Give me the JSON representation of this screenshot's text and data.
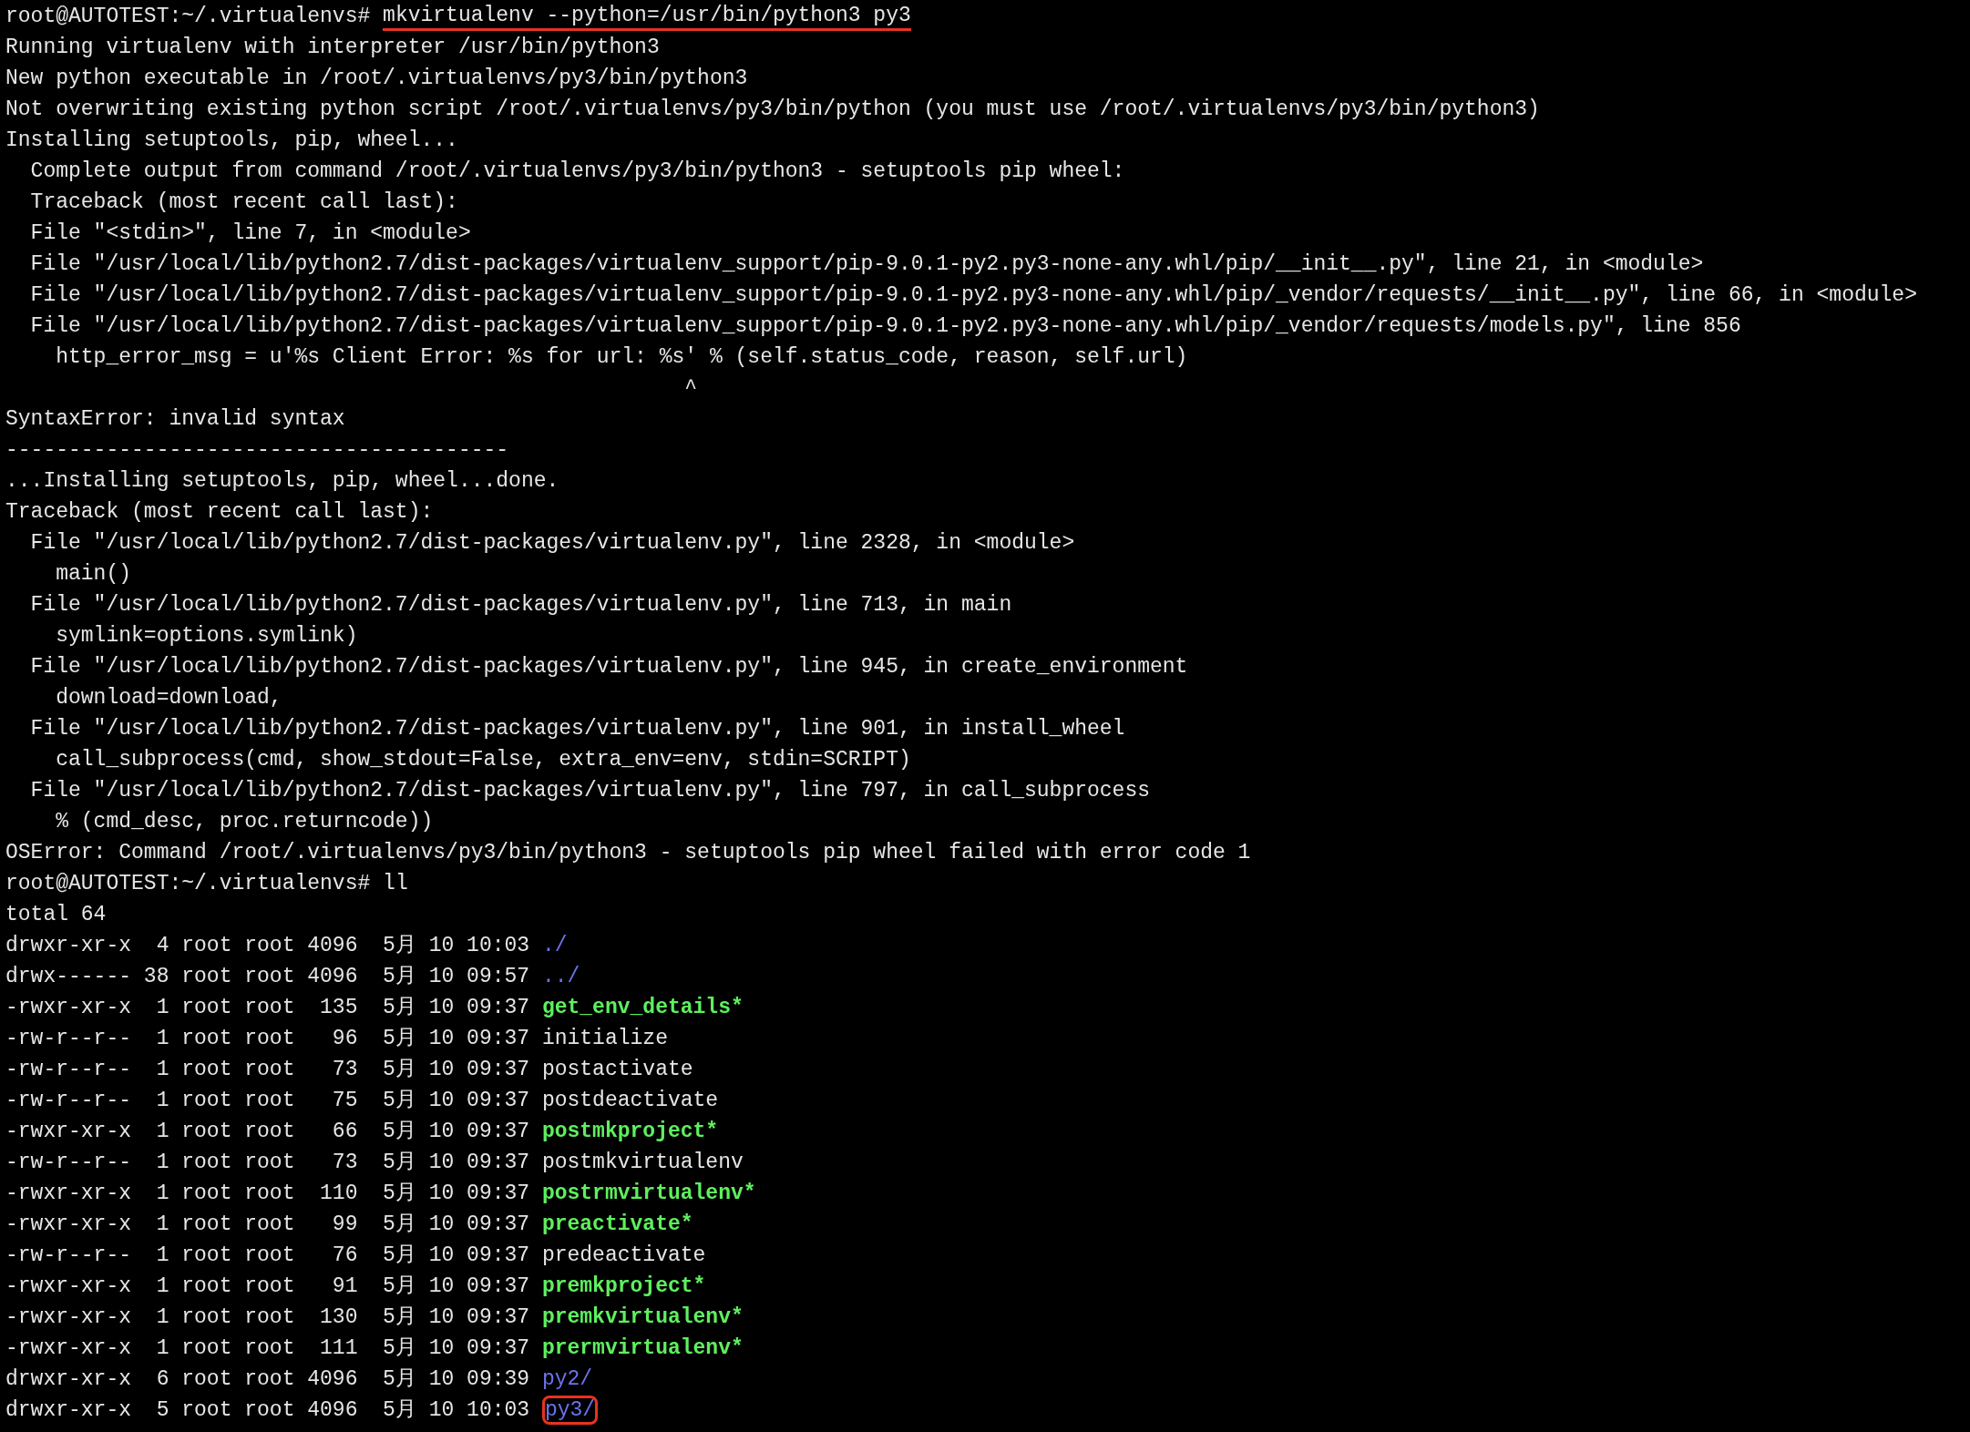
{
  "terminal": {
    "lines": [
      {
        "kind": "prompt",
        "prompt": "root@AUTOTEST:~/.virtualenvs# ",
        "command": "mkvirtualenv --python=/usr/bin/python3 py3",
        "underlined": true
      },
      {
        "kind": "text",
        "text": "Running virtualenv with interpreter /usr/bin/python3"
      },
      {
        "kind": "text",
        "text": "New python executable in /root/.virtualenvs/py3/bin/python3"
      },
      {
        "kind": "text",
        "text": "Not overwriting existing python script /root/.virtualenvs/py3/bin/python (you must use /root/.virtualenvs/py3/bin/python3)"
      },
      {
        "kind": "text",
        "text": "Installing setuptools, pip, wheel..."
      },
      {
        "kind": "text",
        "text": "  Complete output from command /root/.virtualenvs/py3/bin/python3 - setuptools pip wheel:"
      },
      {
        "kind": "text",
        "text": "  Traceback (most recent call last):"
      },
      {
        "kind": "text",
        "text": "  File \"<stdin>\", line 7, in <module>"
      },
      {
        "kind": "text",
        "text": "  File \"/usr/local/lib/python2.7/dist-packages/virtualenv_support/pip-9.0.1-py2.py3-none-any.whl/pip/__init__.py\", line 21, in <module>"
      },
      {
        "kind": "text",
        "text": "  File \"/usr/local/lib/python2.7/dist-packages/virtualenv_support/pip-9.0.1-py2.py3-none-any.whl/pip/_vendor/requests/__init__.py\", line 66, in <module>"
      },
      {
        "kind": "text",
        "text": "  File \"/usr/local/lib/python2.7/dist-packages/virtualenv_support/pip-9.0.1-py2.py3-none-any.whl/pip/_vendor/requests/models.py\", line 856"
      },
      {
        "kind": "text",
        "text": "    http_error_msg = u'%s Client Error: %s for url: %s' % (self.status_code, reason, self.url)"
      },
      {
        "kind": "text",
        "text": "                                                      ^"
      },
      {
        "kind": "text",
        "text": "SyntaxError: invalid syntax"
      },
      {
        "kind": "text",
        "text": "----------------------------------------"
      },
      {
        "kind": "text",
        "text": "...Installing setuptools, pip, wheel...done."
      },
      {
        "kind": "text",
        "text": "Traceback (most recent call last):"
      },
      {
        "kind": "text",
        "text": "  File \"/usr/local/lib/python2.7/dist-packages/virtualenv.py\", line 2328, in <module>"
      },
      {
        "kind": "text",
        "text": "    main()"
      },
      {
        "kind": "text",
        "text": "  File \"/usr/local/lib/python2.7/dist-packages/virtualenv.py\", line 713, in main"
      },
      {
        "kind": "text",
        "text": "    symlink=options.symlink)"
      },
      {
        "kind": "text",
        "text": "  File \"/usr/local/lib/python2.7/dist-packages/virtualenv.py\", line 945, in create_environment"
      },
      {
        "kind": "text",
        "text": "    download=download,"
      },
      {
        "kind": "text",
        "text": "  File \"/usr/local/lib/python2.7/dist-packages/virtualenv.py\", line 901, in install_wheel"
      },
      {
        "kind": "text",
        "text": "    call_subprocess(cmd, show_stdout=False, extra_env=env, stdin=SCRIPT)"
      },
      {
        "kind": "text",
        "text": "  File \"/usr/local/lib/python2.7/dist-packages/virtualenv.py\", line 797, in call_subprocess"
      },
      {
        "kind": "text",
        "text": "    % (cmd_desc, proc.returncode))"
      },
      {
        "kind": "text",
        "text": "OSError: Command /root/.virtualenvs/py3/bin/python3 - setuptools pip wheel failed with error code 1"
      },
      {
        "kind": "prompt",
        "prompt": "root@AUTOTEST:~/.virtualenvs# ",
        "command": "ll",
        "underlined": false
      },
      {
        "kind": "text",
        "text": "total 64"
      },
      {
        "kind": "ls",
        "info": "drwxr-xr-x  4 root root 4096  5月 10 10:03 ",
        "file": {
          "kind": "dir",
          "text": "./"
        },
        "circled": false
      },
      {
        "kind": "ls",
        "info": "drwx------ 38 root root 4096  5月 10 09:57 ",
        "file": {
          "kind": "dir",
          "text": "../"
        },
        "circled": false
      },
      {
        "kind": "ls",
        "info": "-rwxr-xr-x  1 root root  135  5月 10 09:37 ",
        "file": {
          "kind": "exec",
          "text": "get_env_details*"
        },
        "circled": false
      },
      {
        "kind": "ls",
        "info": "-rw-r--r--  1 root root   96  5月 10 09:37 ",
        "file": {
          "kind": "file",
          "text": "initialize"
        },
        "circled": false
      },
      {
        "kind": "ls",
        "info": "-rw-r--r--  1 root root   73  5月 10 09:37 ",
        "file": {
          "kind": "file",
          "text": "postactivate"
        },
        "circled": false
      },
      {
        "kind": "ls",
        "info": "-rw-r--r--  1 root root   75  5月 10 09:37 ",
        "file": {
          "kind": "file",
          "text": "postdeactivate"
        },
        "circled": false
      },
      {
        "kind": "ls",
        "info": "-rwxr-xr-x  1 root root   66  5月 10 09:37 ",
        "file": {
          "kind": "exec",
          "text": "postmkproject*"
        },
        "circled": false
      },
      {
        "kind": "ls",
        "info": "-rw-r--r--  1 root root   73  5月 10 09:37 ",
        "file": {
          "kind": "file",
          "text": "postmkvirtualenv"
        },
        "circled": false
      },
      {
        "kind": "ls",
        "info": "-rwxr-xr-x  1 root root  110  5月 10 09:37 ",
        "file": {
          "kind": "exec",
          "text": "postrmvirtualenv*"
        },
        "circled": false
      },
      {
        "kind": "ls",
        "info": "-rwxr-xr-x  1 root root   99  5月 10 09:37 ",
        "file": {
          "kind": "exec",
          "text": "preactivate*"
        },
        "circled": false
      },
      {
        "kind": "ls",
        "info": "-rw-r--r--  1 root root   76  5月 10 09:37 ",
        "file": {
          "kind": "file",
          "text": "predeactivate"
        },
        "circled": false
      },
      {
        "kind": "ls",
        "info": "-rwxr-xr-x  1 root root   91  5月 10 09:37 ",
        "file": {
          "kind": "exec",
          "text": "premkproject*"
        },
        "circled": false
      },
      {
        "kind": "ls",
        "info": "-rwxr-xr-x  1 root root  130  5月 10 09:37 ",
        "file": {
          "kind": "exec",
          "text": "premkvirtualenv*"
        },
        "circled": false
      },
      {
        "kind": "ls",
        "info": "-rwxr-xr-x  1 root root  111  5月 10 09:37 ",
        "file": {
          "kind": "exec",
          "text": "prermvirtualenv*"
        },
        "circled": false
      },
      {
        "kind": "ls",
        "info": "drwxr-xr-x  6 root root 4096  5月 10 09:39 ",
        "file": {
          "kind": "dir",
          "text": "py2/"
        },
        "circled": false
      },
      {
        "kind": "ls",
        "info": "drwxr-xr-x  5 root root 4096  5月 10 10:03 ",
        "file": {
          "kind": "dir",
          "text": "py3/"
        },
        "circled": true
      }
    ]
  }
}
